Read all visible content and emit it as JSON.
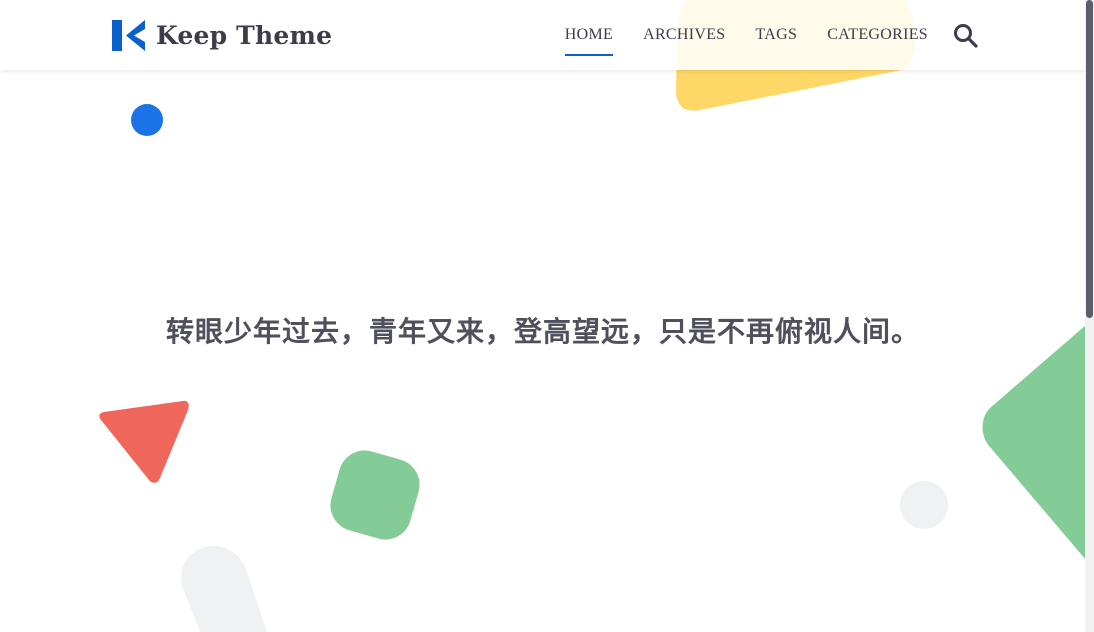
{
  "header": {
    "brand": "Keep Theme",
    "nav": [
      {
        "label": "HOME",
        "active": true
      },
      {
        "label": "ARCHIVES",
        "active": false
      },
      {
        "label": "TAGS",
        "active": false
      },
      {
        "label": "CATEGORIES",
        "active": false
      }
    ],
    "search_icon": "search-icon"
  },
  "hero": {
    "quote": "转眼少年过去，青年又来，登高望远，只是不再俯视人间。"
  },
  "colors": {
    "accent": "#0a61c9",
    "text": "#3c3c4a",
    "shape_yellow": "#ffd55e",
    "shape_green": "#83cb97",
    "shape_red": "#ef675b",
    "shape_blue": "#1a74e8",
    "shape_gray": "#f0f1f3"
  }
}
